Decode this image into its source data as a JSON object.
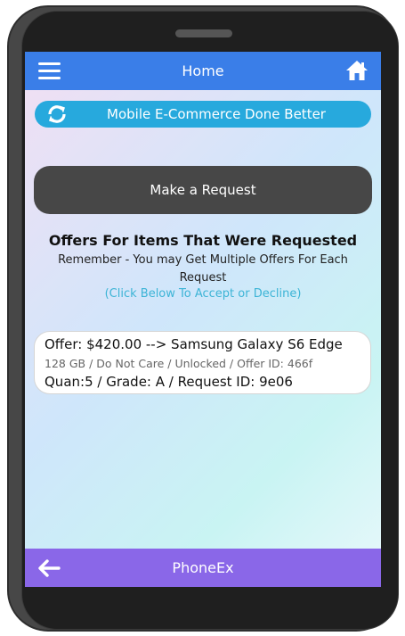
{
  "header": {
    "title": "Home",
    "menu_icon": "hamburger-menu-icon",
    "home_icon": "home-icon",
    "color": "#3a7ee8"
  },
  "banner": {
    "text": "Mobile E-Commerce Done Better",
    "icon": "refresh-icon",
    "color": "#27a9dd"
  },
  "request_button": {
    "label": "Make a Request"
  },
  "offers_section": {
    "title": "Offers For Items That Were Requested",
    "subtitle": "Remember - You may Get Multiple Offers For Each Request",
    "hint": "(Click Below To Accept or Decline)"
  },
  "offers": [
    {
      "line1": "Offer: $420.00 --> Samsung Galaxy S6 Edge",
      "line2": "128 GB / Do Not Care / Unlocked / Offer ID: 466f",
      "line3": "Quan:5 / Grade: A / Request ID: 9e06"
    }
  ],
  "footer": {
    "title": "PhoneEx",
    "back_icon": "back-arrow-icon",
    "color": "#8a67e8"
  }
}
